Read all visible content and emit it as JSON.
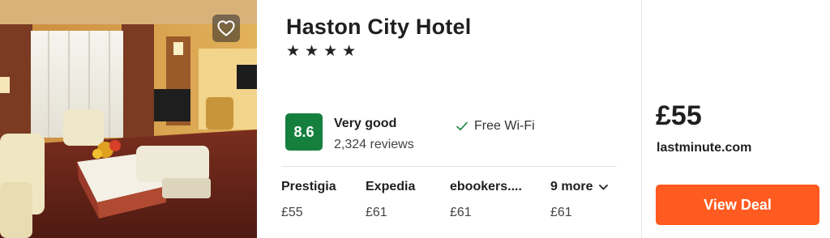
{
  "hotel": {
    "name": "Haston City Hotel",
    "stars": 4,
    "star_glyph": "★",
    "photo_alt": "hotel room photo",
    "favorite_icon": "heart-outline-icon"
  },
  "rating": {
    "score": "8.6",
    "label": "Very good",
    "reviews": "2,324 reviews",
    "color": "#15803d"
  },
  "amenities": [
    {
      "icon": "check-icon",
      "label": "Free Wi-Fi"
    }
  ],
  "providers": [
    {
      "name": "Prestigia",
      "price": "£55"
    },
    {
      "name": "Expedia",
      "price": "£61"
    },
    {
      "name": "ebookers....",
      "price": "£61"
    }
  ],
  "more_providers": {
    "label": "9 more",
    "price": "£61",
    "icon": "chevron-down-icon"
  },
  "deal": {
    "price": "£55",
    "site": "lastminute.com",
    "button_label": "View Deal",
    "button_color": "#ff5a1f"
  }
}
